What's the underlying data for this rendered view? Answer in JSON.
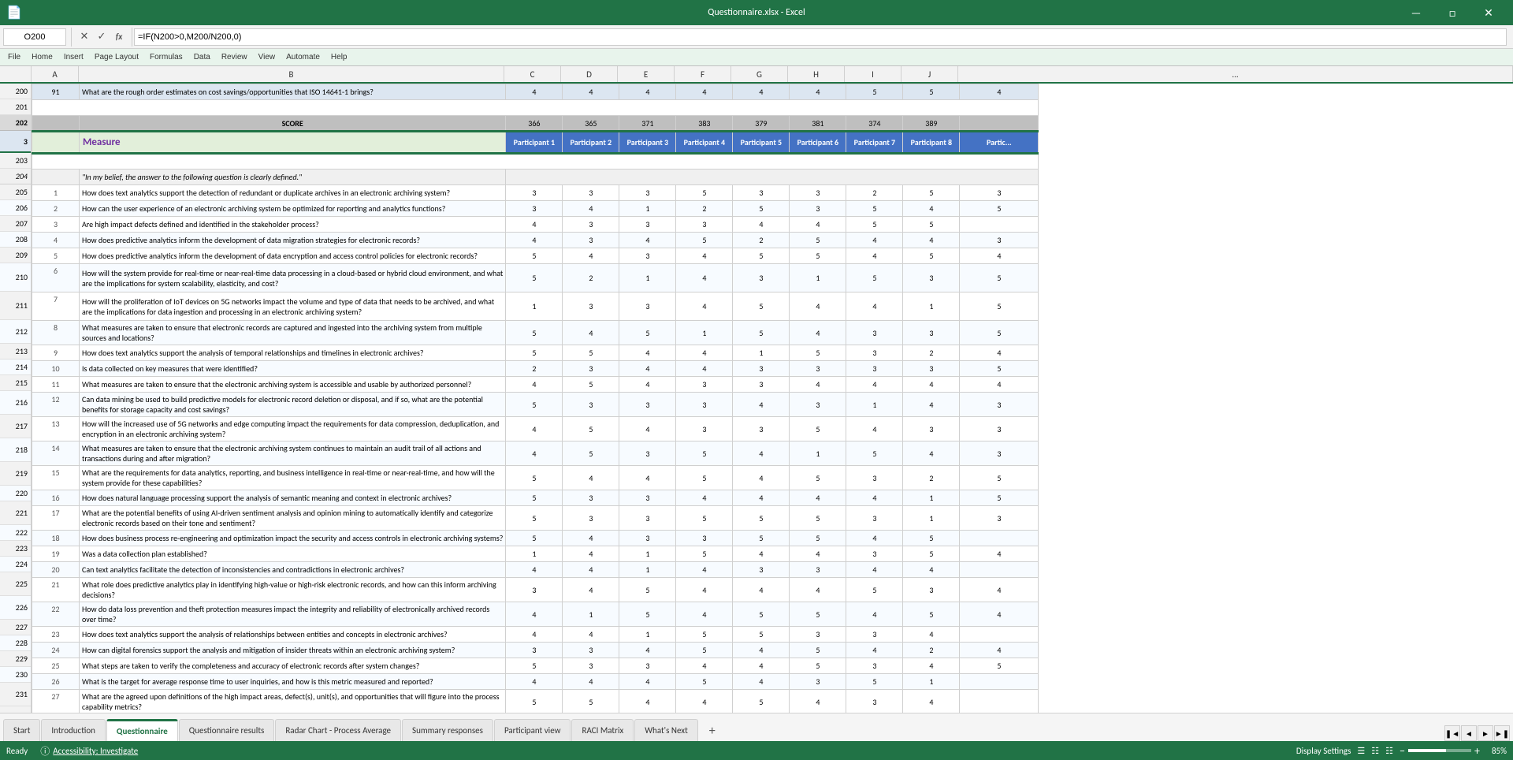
{
  "titleBar": {
    "title": "Questionnaire.xlsx - Excel",
    "windowControls": [
      "—",
      "⬜",
      "✕"
    ]
  },
  "formulaBar": {
    "nameBox": "O200",
    "formula": "=IF(N200>0,M200/N200,0)",
    "icons": [
      "✕",
      "✓",
      "fx"
    ]
  },
  "ribbon": {
    "tabs": [
      "File",
      "Home",
      "Insert",
      "Page Layout",
      "Formulas",
      "Data",
      "Review",
      "View",
      "Automate",
      "Help"
    ]
  },
  "columnHeaders": [
    "A",
    "B",
    "C",
    "D",
    "E",
    "F",
    "G",
    "H",
    "I",
    "J"
  ],
  "spreadsheetRows": [
    {
      "rowNum": "200",
      "sub": "91",
      "type": "data",
      "cells": [
        "91",
        "What are the rough order estimates on cost savings/opportunities that ISO 14641-1 brings?",
        "4",
        "4",
        "4",
        "4",
        "4",
        "4",
        "5",
        "5",
        "4"
      ]
    },
    {
      "rowNum": "201",
      "sub": "",
      "type": "empty",
      "cells": [
        "",
        "",
        "",
        "",
        "",
        "",
        "",
        "",
        "",
        "",
        ""
      ]
    },
    {
      "rowNum": "202",
      "sub": "",
      "type": "score",
      "cells": [
        "",
        "SCORE",
        "366",
        "365",
        "371",
        "383",
        "379",
        "381",
        "374",
        "389",
        ""
      ]
    },
    {
      "rowNum": "3",
      "sub": "",
      "type": "measure-header",
      "cells": [
        "",
        "Measure",
        "Participant 1",
        "Participant 2",
        "Participant 3",
        "Participant 4",
        "Participant 5",
        "Participant 6",
        "Participant 7",
        "Participant 8",
        "Partic..."
      ]
    },
    {
      "rowNum": "203",
      "sub": "",
      "type": "empty",
      "cells": [
        "",
        "",
        "",
        "",
        "",
        "",
        "",
        "",
        "",
        "",
        ""
      ]
    },
    {
      "rowNum": "204",
      "sub": "",
      "type": "section",
      "cells": [
        "",
        "\"In my belief, the answer to the following question is clearly defined.\"",
        "",
        "",
        "",
        "",
        "",
        "",
        "",
        "",
        ""
      ]
    },
    {
      "rowNum": "205",
      "sub": "1",
      "type": "data",
      "cells": [
        "1",
        "How does text analytics support the detection of redundant or duplicate archives in an electronic archiving system?",
        "3",
        "3",
        "3",
        "5",
        "3",
        "3",
        "2",
        "5",
        "3"
      ]
    },
    {
      "rowNum": "206",
      "sub": "2",
      "type": "data",
      "cells": [
        "2",
        "How can the user experience of an electronic archiving system be optimized for reporting and analytics functions?",
        "3",
        "4",
        "1",
        "2",
        "5",
        "3",
        "5",
        "4",
        "5"
      ]
    },
    {
      "rowNum": "207",
      "sub": "3",
      "type": "data",
      "cells": [
        "3",
        "Are high impact defects defined and identified in the stakeholder process?",
        "4",
        "3",
        "3",
        "3",
        "4",
        "4",
        "5",
        "5",
        ""
      ]
    },
    {
      "rowNum": "208",
      "sub": "4",
      "type": "data",
      "cells": [
        "4",
        "How does predictive analytics inform the development of data migration strategies for electronic records?",
        "4",
        "3",
        "4",
        "5",
        "2",
        "5",
        "4",
        "4",
        "3"
      ]
    },
    {
      "rowNum": "209",
      "sub": "5",
      "type": "data",
      "cells": [
        "5",
        "How does predictive analytics inform the development of data encryption and access control policies for electronic records?",
        "5",
        "4",
        "3",
        "4",
        "5",
        "5",
        "4",
        "5",
        "4"
      ]
    },
    {
      "rowNum": "210",
      "sub": "6",
      "type": "data-tall",
      "cells": [
        "6",
        "How will the system provide for real-time or near-real-time data processing in a cloud-based or hybrid cloud environment, and what are the implications for system scalability, elasticity, and cost?",
        "5",
        "2",
        "1",
        "4",
        "3",
        "1",
        "5",
        "3",
        "5"
      ]
    },
    {
      "rowNum": "211",
      "sub": "7",
      "type": "data-tall",
      "cells": [
        "7",
        "How will the proliferation of IoT devices on 5G networks impact the volume and type of data that needs to be archived, and what are the implications for data ingestion and processing in an electronic archiving system?",
        "1",
        "3",
        "3",
        "4",
        "5",
        "4",
        "4",
        "1",
        "5"
      ]
    },
    {
      "rowNum": "212",
      "sub": "8",
      "type": "data-tall",
      "cells": [
        "8",
        "What measures are taken to ensure that electronic records are captured and ingested into the archiving system from multiple sources and locations?",
        "5",
        "4",
        "5",
        "1",
        "5",
        "4",
        "3",
        "3",
        "5"
      ]
    },
    {
      "rowNum": "213",
      "sub": "9",
      "type": "data",
      "cells": [
        "9",
        "How does text analytics support the analysis of temporal relationships and timelines in electronic archives?",
        "5",
        "5",
        "4",
        "4",
        "1",
        "5",
        "3",
        "2",
        "4"
      ]
    },
    {
      "rowNum": "214",
      "sub": "10",
      "type": "data",
      "cells": [
        "10",
        "Is data collected on key measures that were identified?",
        "2",
        "3",
        "4",
        "4",
        "3",
        "3",
        "3",
        "3",
        "5"
      ]
    },
    {
      "rowNum": "215",
      "sub": "11",
      "type": "data",
      "cells": [
        "11",
        "What measures are taken to ensure that the electronic archiving system is accessible and usable by authorized personnel?",
        "4",
        "5",
        "4",
        "3",
        "3",
        "4",
        "4",
        "4",
        "4"
      ]
    },
    {
      "rowNum": "216",
      "sub": "12",
      "type": "data-tall",
      "cells": [
        "12",
        "Can data mining be used to build predictive models for electronic record deletion or disposal, and if so, what are the potential benefits for storage capacity and cost savings?",
        "5",
        "3",
        "3",
        "3",
        "4",
        "3",
        "1",
        "4",
        "3"
      ]
    },
    {
      "rowNum": "217",
      "sub": "13",
      "type": "data-tall",
      "cells": [
        "13",
        "How will the increased use of 5G networks and edge computing impact the requirements for data compression, deduplication, and encryption in an electronic archiving system?",
        "4",
        "5",
        "4",
        "3",
        "3",
        "5",
        "4",
        "3",
        "3"
      ]
    },
    {
      "rowNum": "218",
      "sub": "14",
      "type": "data-tall",
      "cells": [
        "14",
        "What measures are taken to ensure that the electronic archiving system continues to maintain an audit trail of all actions and transactions during and after migration?",
        "4",
        "5",
        "3",
        "5",
        "4",
        "1",
        "5",
        "4",
        "3"
      ]
    },
    {
      "rowNum": "219",
      "sub": "15",
      "type": "data-tall",
      "cells": [
        "15",
        "What are the requirements for data analytics, reporting, and business intelligence in real-time or near-real-time, and how will the system provide for these capabilities?",
        "5",
        "4",
        "4",
        "5",
        "4",
        "5",
        "3",
        "2",
        "5"
      ]
    },
    {
      "rowNum": "220",
      "sub": "16",
      "type": "data",
      "cells": [
        "16",
        "How does natural language processing support the analysis of semantic meaning and context in electronic archives?",
        "5",
        "3",
        "3",
        "4",
        "4",
        "4",
        "4",
        "1",
        "5"
      ]
    },
    {
      "rowNum": "221",
      "sub": "17",
      "type": "data-tall",
      "cells": [
        "17",
        "What are the potential benefits of using AI-driven sentiment analysis and opinion mining to automatically identify and categorize electronic records based on their tone and sentiment?",
        "5",
        "3",
        "3",
        "5",
        "5",
        "5",
        "3",
        "1",
        "3"
      ]
    },
    {
      "rowNum": "222",
      "sub": "18",
      "type": "data",
      "cells": [
        "18",
        "How does business process re-engineering and optimization impact the security and access controls in electronic archiving systems?",
        "5",
        "4",
        "3",
        "3",
        "5",
        "5",
        "4",
        "5",
        ""
      ]
    },
    {
      "rowNum": "223",
      "sub": "19",
      "type": "data",
      "cells": [
        "19",
        "Was a data collection plan established?",
        "1",
        "4",
        "1",
        "5",
        "4",
        "4",
        "3",
        "5",
        "4"
      ]
    },
    {
      "rowNum": "224",
      "sub": "20",
      "type": "data",
      "cells": [
        "20",
        "Can text analytics facilitate the detection of inconsistencies and contradictions in electronic archives?",
        "4",
        "4",
        "1",
        "4",
        "3",
        "3",
        "4",
        "4",
        ""
      ]
    },
    {
      "rowNum": "225",
      "sub": "21",
      "type": "data-tall",
      "cells": [
        "21",
        "What role does predictive analytics play in identifying high-value or high-risk electronic records, and how can this inform archiving decisions?",
        "3",
        "4",
        "5",
        "4",
        "4",
        "4",
        "5",
        "3",
        "4"
      ]
    },
    {
      "rowNum": "226",
      "sub": "22",
      "type": "data-tall",
      "cells": [
        "22",
        "How do data loss prevention and theft protection measures impact the integrity and reliability of electronically archived records over time?",
        "4",
        "1",
        "5",
        "4",
        "5",
        "5",
        "4",
        "5",
        "4"
      ]
    },
    {
      "rowNum": "227",
      "sub": "23",
      "type": "data",
      "cells": [
        "23",
        "How does text analytics support the analysis of relationships between entities and concepts in electronic archives?",
        "4",
        "4",
        "1",
        "5",
        "5",
        "3",
        "3",
        "4",
        ""
      ]
    },
    {
      "rowNum": "228",
      "sub": "24",
      "type": "data",
      "cells": [
        "24",
        "How can digital forensics support the analysis and mitigation of insider threats within an electronic archiving system?",
        "3",
        "3",
        "4",
        "5",
        "4",
        "5",
        "4",
        "2",
        "4"
      ]
    },
    {
      "rowNum": "229",
      "sub": "25",
      "type": "data",
      "cells": [
        "25",
        "What steps are taken to verify the completeness and accuracy of electronic records after system changes?",
        "5",
        "3",
        "3",
        "4",
        "4",
        "5",
        "3",
        "4",
        "5"
      ]
    },
    {
      "rowNum": "230",
      "sub": "26",
      "type": "data",
      "cells": [
        "26",
        "What is the target for average response time to user inquiries, and how is this metric measured and reported?",
        "4",
        "4",
        "4",
        "5",
        "4",
        "3",
        "5",
        "1",
        ""
      ]
    },
    {
      "rowNum": "231",
      "sub": "27",
      "type": "data-tall",
      "cells": [
        "27",
        "What are the agreed upon definitions of the high impact areas, defect(s), unit(s), and opportunities that will figure into the process capability metrics?",
        "5",
        "5",
        "4",
        "4",
        "5",
        "4",
        "3",
        "4",
        ""
      ]
    }
  ],
  "tabs": [
    {
      "label": "Start",
      "active": false
    },
    {
      "label": "Introduction",
      "active": false
    },
    {
      "label": "Questionnaire",
      "active": true
    },
    {
      "label": "Questionnaire results",
      "active": false
    },
    {
      "label": "Radar Chart - Process Average",
      "active": false
    },
    {
      "label": "Summary responses",
      "active": false
    },
    {
      "label": "Participant view",
      "active": false
    },
    {
      "label": "RACI Matrix",
      "active": false
    },
    {
      "label": "What's Next",
      "active": false
    }
  ],
  "statusBar": {
    "ready": "Ready",
    "accessibility": "Accessibility: Investigate",
    "displaySettings": "Display Settings",
    "zoom": "85%"
  }
}
